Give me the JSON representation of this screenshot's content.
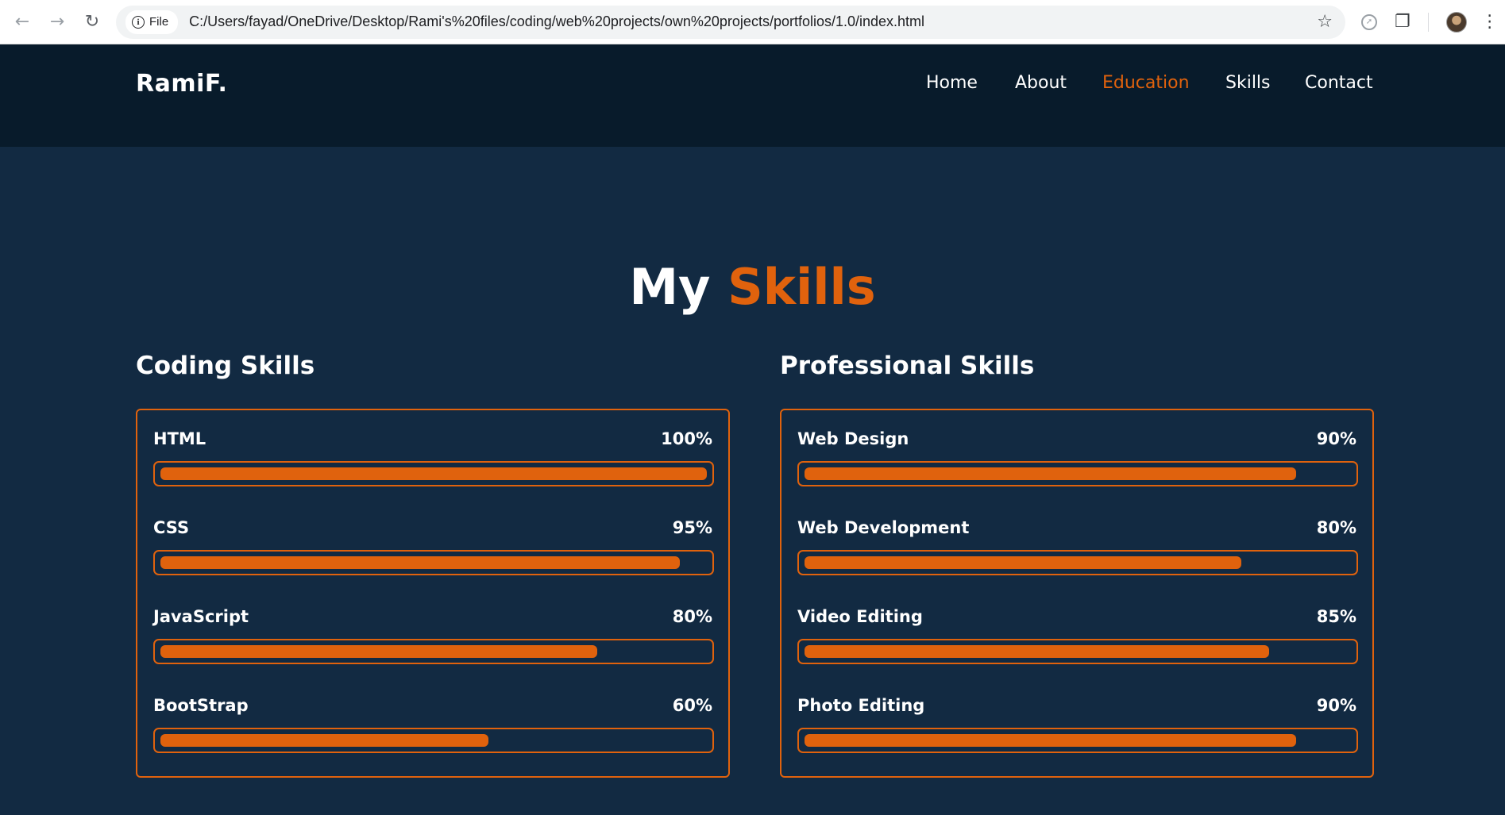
{
  "browser": {
    "file_label": "File",
    "url": "C:/Users/fayad/OneDrive/Desktop/Rami's%20files/coding/web%20projects/own%20projects/portfolios/1.0/index.html"
  },
  "site": {
    "logo": "RamiF.",
    "nav": [
      {
        "label": "Home",
        "active": false
      },
      {
        "label": "About",
        "active": false
      },
      {
        "label": "Education",
        "active": true
      },
      {
        "label": "Skills",
        "active": false
      },
      {
        "label": "Contact",
        "active": false
      }
    ]
  },
  "skills_section": {
    "heading_main": "My",
    "heading_accent": "Skills",
    "accent_color": "#e0620d",
    "columns": [
      {
        "title": "Coding Skills",
        "items": [
          {
            "name": "HTML",
            "percent_label": "100%",
            "level": 100
          },
          {
            "name": "CSS",
            "percent_label": "95%",
            "level": 95
          },
          {
            "name": "JavaScript",
            "percent_label": "80%",
            "level": 80
          },
          {
            "name": "BootStrap",
            "percent_label": "60%",
            "level": 60
          }
        ]
      },
      {
        "title": "Professional Skills",
        "items": [
          {
            "name": "Web Design",
            "percent_label": "90%",
            "level": 90
          },
          {
            "name": "Web Development",
            "percent_label": "80%",
            "level": 80
          },
          {
            "name": "Video Editing",
            "percent_label": "85%",
            "level": 85
          },
          {
            "name": "Photo Editing",
            "percent_label": "90%",
            "level": 90
          }
        ]
      }
    ]
  }
}
